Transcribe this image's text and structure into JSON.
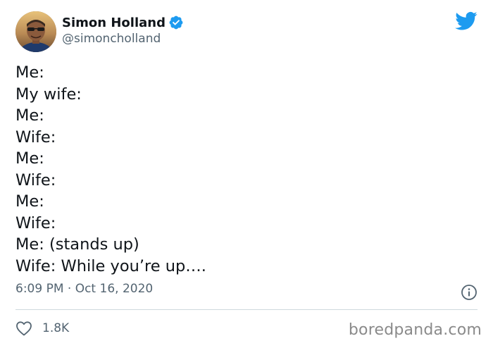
{
  "author": {
    "display_name": "Simon Holland",
    "handle": "@simoncholland",
    "verified": true
  },
  "tweet": {
    "lines": [
      "Me:",
      "My wife:",
      "Me:",
      "Wife:",
      "Me:",
      "Wife:",
      "Me:",
      "Wife:",
      "Me: (stands up)",
      "Wife: While you’re up…."
    ],
    "timestamp": "6:09 PM · Oct 16, 2020",
    "likes": "1.8K"
  },
  "icons": {
    "brand": "twitter-bird-icon",
    "verified": "verified-badge-icon",
    "info": "info-icon",
    "like": "heart-icon"
  },
  "colors": {
    "twitter_blue": "#1d9bf0",
    "text_primary": "#0f1419",
    "text_secondary": "#536471",
    "divider": "#cfd9de"
  },
  "watermark": "boredpanda.com"
}
